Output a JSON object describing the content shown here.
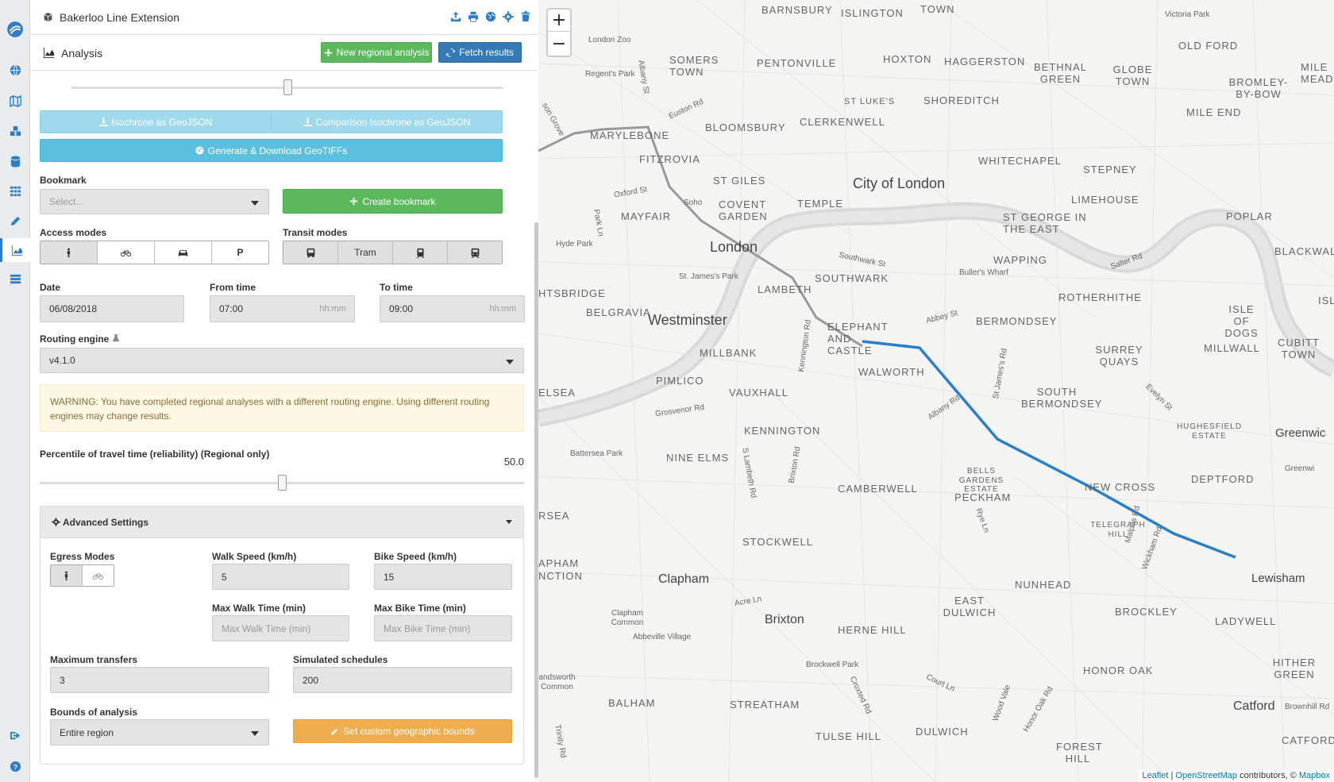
{
  "app": {
    "project_title": "Bakerloo Line Extension",
    "section_title": "Analysis"
  },
  "actions": {
    "new_regional_analysis": "New regional analysis",
    "fetch_results": "Fetch results",
    "isochrone_geojson": "Isochrone as GeoJSON",
    "comparison_isochrone_geojson": "Comparison Isochrone as GeoJSON",
    "generate_geotiffs": "Generate & Download GeoTIFFs",
    "create_bookmark": "Create bookmark",
    "set_custom_bounds": "Set custom geographic bounds"
  },
  "bookmark": {
    "label": "Bookmark",
    "placeholder": "Select..."
  },
  "access_modes": {
    "label": "Access modes",
    "options": [
      "walk-icon",
      "bicycle-icon",
      "car-icon",
      "P"
    ],
    "selected": "walk"
  },
  "transit_modes": {
    "label": "Transit modes",
    "options": [
      "bus-icon",
      "Tram",
      "subway-icon",
      "rail-icon"
    ],
    "tram_label": "Tram"
  },
  "date": {
    "label": "Date",
    "value": "06/08/2018"
  },
  "from_time": {
    "label": "From time",
    "value": "07:00",
    "hint": "hh:mm"
  },
  "to_time": {
    "label": "To time",
    "value": "09:00",
    "hint": "hh:mm"
  },
  "routing_engine": {
    "label": "Routing engine",
    "value": "v4.1.0"
  },
  "warning": "WARNING: You have completed regional analyses with a different routing engine. Using different routing engines may change results.",
  "percentile": {
    "label": "Percentile of travel time (reliability) (Regional only)",
    "value": "50.0",
    "slider_fraction": 0.5
  },
  "top_slider_fraction": 0.5,
  "advanced": {
    "title": "Advanced Settings",
    "egress_label": "Egress Modes",
    "walk_speed_label": "Walk Speed (km/h)",
    "walk_speed": "5",
    "bike_speed_label": "Bike Speed (km/h)",
    "bike_speed": "15",
    "max_walk_label": "Max Walk Time (min)",
    "max_walk_placeholder": "Max Walk Time (min)",
    "max_bike_label": "Max Bike Time (min)",
    "max_bike_placeholder": "Max Bike Time (min)",
    "max_transfers_label": "Maximum transfers",
    "max_transfers": "3",
    "sim_schedules_label": "Simulated schedules",
    "sim_schedules": "200",
    "bounds_label": "Bounds of analysis",
    "bounds_value": "Entire region"
  },
  "map": {
    "zoom_in": "+",
    "zoom_out": "−",
    "attribution_leaflet": "Leaflet",
    "attribution_sep": " | ",
    "attribution_osm": "OpenStreetMap",
    "attribution_rest": " contributors, © ",
    "attribution_mapbox": "Mapbox",
    "labels": {
      "barnsbury": "BARNSBURY",
      "islington": "ISLINGTON",
      "town": "TOWN",
      "victoria_park": "Victoria Park",
      "london_zoo": "London Zoo",
      "somers_town": "SOMERS TOWN",
      "pentonville": "PENTONVILLE",
      "hoxton": "HOXTON",
      "haggerston": "HAGGERSTON",
      "bethnal_green": "BETHNAL GREEN",
      "globe_town": "GLOBE TOWN",
      "old_ford": "OLD FORD",
      "mile_meads": "MILE MEADS",
      "bromley_by_bow": "BROMLEY- BY-BOW",
      "regents_park": "Regent's Park",
      "albany_st": "Albany St",
      "euston_rd": "Euston Rd",
      "st_lukes": "ST LUKE'S",
      "shoreditch": "SHOREDITCH",
      "mile_end": "MILE END",
      "son_grove": "son Grove",
      "marylebone": "MARYLEBONE",
      "bloomsbury": "BLOOMSBURY",
      "clerkenwell": "CLERKENWELL",
      "fitzrovia": "FITZROVIA",
      "whitechapel": "WHITECHAPEL",
      "stepney": "STEPNEY",
      "oxford_st": "Oxford St",
      "soho": "Soho",
      "st_giles": "ST GILES",
      "city_of_london": "City of London",
      "covent_garden": "COVENT GARDEN",
      "temple": "TEMPLE",
      "mayfair": "MAYFAIR",
      "limehouse": "LIMEHOUSE",
      "st_george": "ST GEORGE IN THE EAST",
      "poplar": "POPLAR",
      "park_ln": "Park Ln",
      "hyde_park": "Hyde Park",
      "london": "London",
      "wapping": "WAPPING",
      "southwark_st": "Southwark St",
      "salter_rd": "Salter Rd",
      "blackwall": "BLACKWALL",
      "st_james_park": "St. James's Park",
      "southwark": "SOUTHWARK",
      "bullers_wharf": "Buller's Wharf",
      "htsbridge": "HTSBRIDGE",
      "lambeth": "LAMBETH",
      "rotherhithe": "ROTHERHITHE",
      "belgravia": "BELGRAVIA",
      "westminster": "Westminster",
      "abbey_st": "Abbey St",
      "bermondsey": "BERMONDSEY",
      "isle_of_dogs": "ISLE OF DOGS",
      "elephant": "ELEPHANT AND CASTLE",
      "kennington_rd": "Kennington Rd",
      "millbank": "MILLBANK",
      "walworth": "WALWORTH",
      "st_james_rd": "St James's Rd",
      "surrey_quays": "SURREY QUAYS",
      "millwall": "MILLWALL",
      "cubitt_town": "CUBITT TOWN",
      "pimlico": "PIMLICO",
      "elsea": "ELSEA",
      "vauxhall": "VAUXHALL",
      "south_bermondsey": "SOUTH BERMONDSEY",
      "evelyn_st": "Evelyn St",
      "grosvenor_rd": "Grosvenor Rd",
      "albany_rd": "Albany Rd",
      "hughesfield": "HUGHESFIELD ESTATE",
      "greenwich": "Greenwic",
      "kennington": "KENNINGTON",
      "battersea_park": "Battersea Park",
      "nine_elms": "NINE ELMS",
      "s_lambeth_rd": "S Lambeth Rd",
      "brixton_rd": "Brixton Rd",
      "bells_gardens": "BELLS GARDENS ESTATE",
      "peckham": "PECKHAM",
      "greenwi": "Greenwi",
      "camberwell": "CAMBERWELL",
      "new_cross": "NEW CROSS",
      "deptford": "DEPTFORD",
      "rsea": "RSEA",
      "rye_ln": "Rye Ln",
      "telegraph_hill": "TELEGRAPH HILL",
      "malpas_rd": "Malpas Rd",
      "stockwell": "STOCKWELL",
      "apham": "APHAM",
      "nction": "NCTION",
      "clapham": "Clapham",
      "wickham_rd": "Wickham Rd",
      "lewisham": "Lewisham",
      "nunhead": "NUNHEAD",
      "acre_ln": "Acre Ln",
      "east_dulwich": "EAST DULWICH",
      "clapham_common": "Clapham Common",
      "brixton": "Brixton",
      "brockley": "BROCKLEY",
      "ladywell": "LADYWELL",
      "herne_hill": "HERNE HILL",
      "abbeville": "Abbeville Village",
      "brockwell_park": "Brockwell Park",
      "honor_oak": "HONOR OAK",
      "hither_green": "HITHER GREEN",
      "court_ln": "Court Ln",
      "andsworth": "andsworth Common",
      "croxted_rd": "Croxted Rd",
      "wood_vale": "Wood Vale",
      "honor_oak_rd": "Honor Oak Rd",
      "balham": "BALHAM",
      "streatham": "STREATHAM",
      "catford": "Catford",
      "brownhill_rd": "Brownhill Rd",
      "dulwich": "DULWICH",
      "tulse_hill": "TULSE HILL",
      "forest_hill": "FOREST HILL",
      "catford2": "CATFORD",
      "trinity_rd": "Trinity Rd"
    }
  }
}
